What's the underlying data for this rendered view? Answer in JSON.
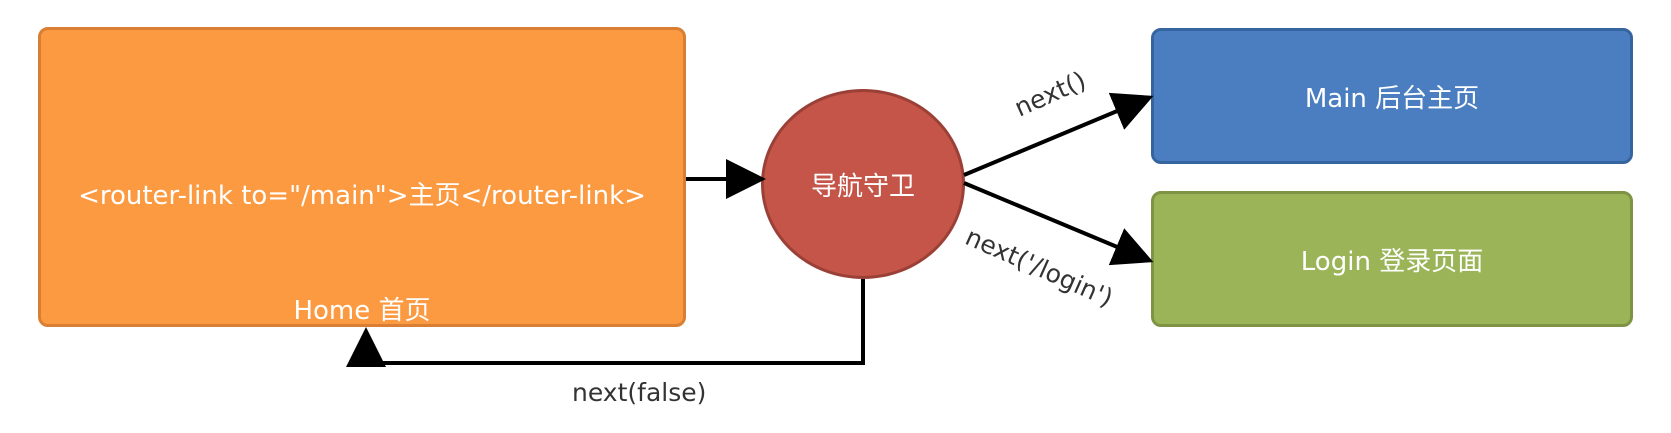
{
  "home": {
    "code": "<router-link to=\"/main\">主页</router-link>",
    "name": "Home 首页"
  },
  "guard": {
    "label": "导航守卫"
  },
  "main": {
    "label": "Main 后台主页"
  },
  "login": {
    "label": "Login 登录页面"
  },
  "edges": {
    "next": "next()",
    "next_login": "next('/login')",
    "next_false": "next(false)"
  },
  "colors": {
    "home": "#fc9a41",
    "guard": "#c45548",
    "main": "#4a7ec0",
    "login": "#9bb458",
    "arrow": "#000000"
  }
}
